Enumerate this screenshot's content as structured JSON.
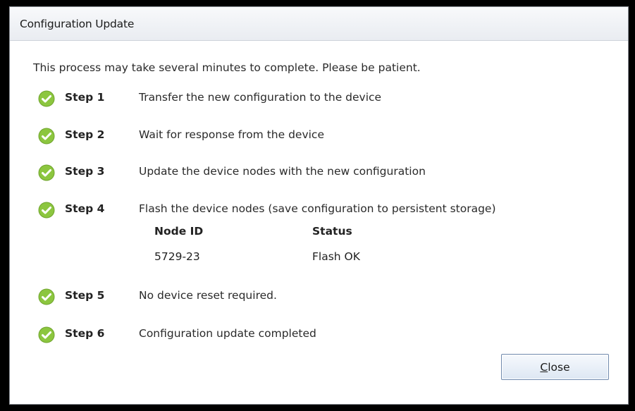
{
  "dialog": {
    "title": "Configuration Update",
    "intro": "This process may take several minutes to complete. Please be patient.",
    "check_icon": "check-circle-icon",
    "check_color": "#8cc63f",
    "steps": [
      {
        "label": "Step 1",
        "description": "Transfer the new configuration to the device",
        "status": "complete"
      },
      {
        "label": "Step 2",
        "description": "Wait for response from the device",
        "status": "complete"
      },
      {
        "label": "Step 3",
        "description": "Update the device nodes with the new configuration",
        "status": "complete"
      },
      {
        "label": "Step 4",
        "description": "Flash the device nodes (save configuration to persistent storage)",
        "status": "complete"
      },
      {
        "label": "Step 5",
        "description": "No device reset required.",
        "status": "complete"
      },
      {
        "label": "Step 6",
        "description": "Configuration update completed",
        "status": "complete"
      }
    ],
    "nodes_table": {
      "headers": [
        "Node ID",
        "Status"
      ],
      "rows": [
        [
          "5729-23",
          "Flash OK"
        ]
      ]
    },
    "close_button": {
      "mnemonic": "C",
      "label_rest": "lose"
    }
  }
}
